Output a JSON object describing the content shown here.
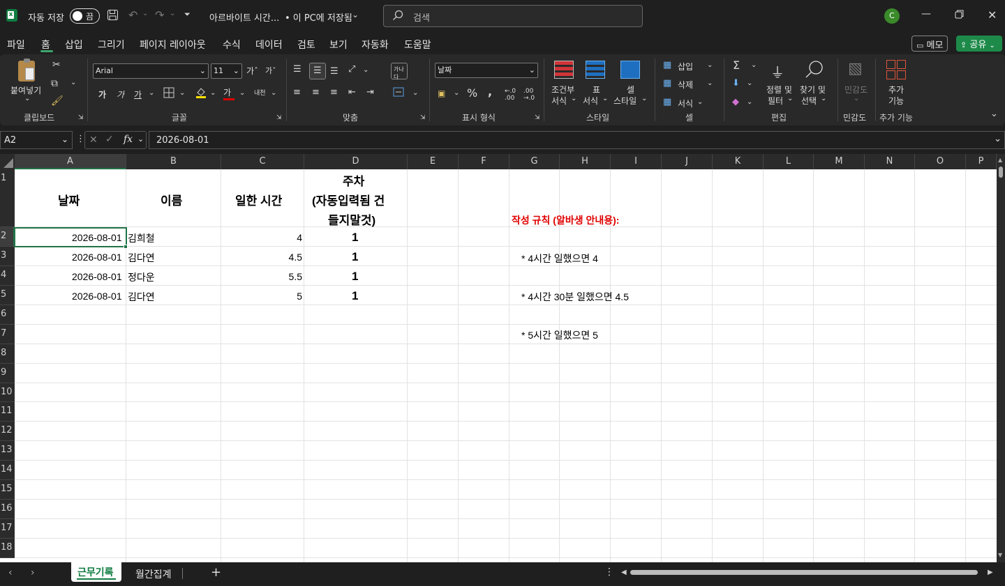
{
  "titlebar": {
    "autosave_label": "자동 저장",
    "autosave_state": "끔",
    "doc_title": "아르바이트 시간...",
    "save_status": "• 이 PC에 저장됨",
    "search_placeholder": "검색",
    "avatar_letter": "C"
  },
  "menu": {
    "tabs": [
      "파일",
      "홈",
      "삽입",
      "그리기",
      "페이지 레이아웃",
      "수식",
      "데이터",
      "검토",
      "보기",
      "자동화",
      "도움말"
    ],
    "active": "홈",
    "memo": "메모",
    "share": "공유"
  },
  "ribbon": {
    "paste": "붙여넣기",
    "font_name": "Arial",
    "font_size": "11",
    "number_format": "날짜",
    "cond_format": [
      "조건부",
      "서식"
    ],
    "table_format": [
      "표",
      "서식"
    ],
    "cell_style": [
      "셀",
      "스타일"
    ],
    "insert": "삽입",
    "delete": "삭제",
    "format": "서식",
    "sort_filter": [
      "정렬 및",
      "필터"
    ],
    "find_select": [
      "찾기 및",
      "선택"
    ],
    "sensitivity": "민감도",
    "addins": [
      "추가",
      "기능"
    ],
    "groups": {
      "clipboard": "클립보드",
      "font": "글꼴",
      "align": "맞춤",
      "number": "표시 형식",
      "style": "스타일",
      "cells": "셀",
      "edit": "편집",
      "sensitivity": "민감도",
      "addins": "추가 기능"
    }
  },
  "formula": {
    "name_box": "A2",
    "fx": "fx",
    "value": "2026-08-01"
  },
  "columns": [
    "A",
    "B",
    "C",
    "D",
    "E",
    "F",
    "G",
    "H",
    "I",
    "J",
    "K",
    "L",
    "M",
    "N",
    "O",
    "P"
  ],
  "rows": [
    "1",
    "2",
    "3",
    "4",
    "5",
    "6",
    "7",
    "8",
    "9",
    "10",
    "11",
    "12",
    "13",
    "14",
    "15",
    "16",
    "17",
    "18"
  ],
  "headers": {
    "date": "날짜",
    "name": "이름",
    "hours": "일한 시간",
    "week_1": "주차",
    "week_2": "(자동입력됨 건",
    "week_3": "들지말것)"
  },
  "data_rows": [
    {
      "date": "2026-08-01",
      "name": "김희철",
      "hours": "4",
      "week": "1"
    },
    {
      "date": "2026-08-01",
      "name": "김다연",
      "hours": "4.5",
      "week": "1"
    },
    {
      "date": "2026-08-01",
      "name": "정다운",
      "hours": "5.5",
      "week": "1"
    },
    {
      "date": "2026-08-01",
      "name": "김다연",
      "hours": "5",
      "week": "1"
    }
  ],
  "notes": {
    "title": "작성 규칙 (알바생 안내용):",
    "line1": "* 4시간 일했으면 4",
    "line2": "* 4시간 30분 일했으면 4.5",
    "line3": "* 5시간 일했으면 5"
  },
  "sheets": {
    "tab1": "근무기록",
    "tab2": "월간집계",
    "add": "+"
  },
  "colors": {
    "accent_green": "#107c41",
    "note_red": "#e00000",
    "selection_green": "#217346"
  }
}
